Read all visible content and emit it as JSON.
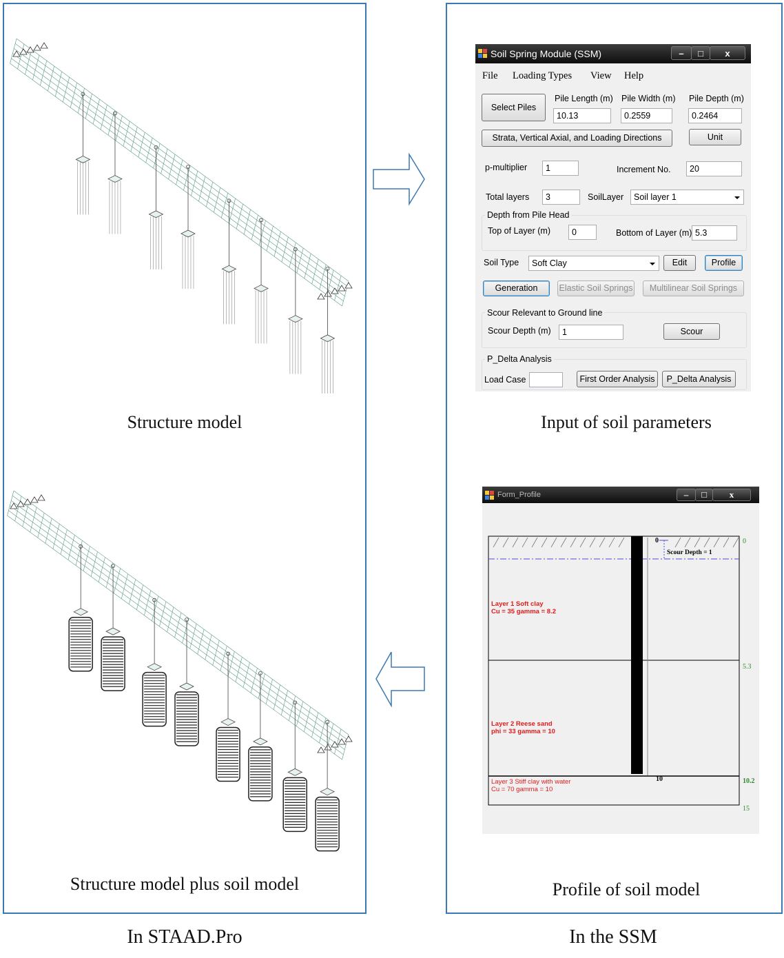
{
  "panels": {
    "structure_model": "Structure model",
    "structure_plus_soil": "Structure model plus soil model",
    "input_soil_params": "Input of soil parameters",
    "profile_soil_model": "Profile of soil model"
  },
  "bottom_labels": {
    "left": "In STAAD.Pro",
    "right": "In the SSM"
  },
  "ssm_window": {
    "title": "Soil Spring Module (SSM)",
    "controls": {
      "minimize": "–",
      "maximize": "□",
      "close": "x"
    },
    "menu": [
      "File",
      "Loading Types",
      "View",
      "Help"
    ],
    "select_piles": "Select Piles",
    "pile_length_label": "Pile Length (m)",
    "pile_length_value": "10.13",
    "pile_width_label": "Pile Width (m)",
    "pile_width_value": "0.2559",
    "pile_depth_label": "Pile Depth (m)",
    "pile_depth_value": "0.2464",
    "strata_button": "Strata, Vertical Axial, and Loading Directions",
    "unit_button": "Unit",
    "p_multiplier_label": "p-multiplier",
    "p_multiplier_value": "1",
    "increment_label": "Increment No.",
    "increment_value": "20",
    "total_layers_label": "Total layers",
    "total_layers_value": "3",
    "soil_layer_label": "SoilLayer",
    "soil_layer_value": "Soil layer 1",
    "depth_group_title": "Depth from Pile Head",
    "top_layer_label": "Top of Layer (m)",
    "top_layer_value": "0",
    "bottom_layer_label": "Bottom of Layer (m)",
    "bottom_layer_value": "5.3",
    "soil_type_label": "Soil Type",
    "soil_type_value": "Soft Clay",
    "edit_button": "Edit",
    "profile_button": "Profile",
    "generation_button": "Generation",
    "elastic_button": "Elastic Soil Springs",
    "multilinear_button": "Multilinear Soil Springs",
    "scour_group_title": "Scour Relevant to Ground line",
    "scour_depth_label": "Scour Depth (m)",
    "scour_depth_value": "1",
    "scour_button": "Scour",
    "pdelta_group_title": "P_Delta Analysis",
    "load_case_label": "Load Case",
    "load_case_value": "",
    "first_order_button": "First Order Analysis",
    "pdelta_button": "P_Delta Analysis"
  },
  "profile_window": {
    "title": "Form_Profile",
    "controls": {
      "minimize": "–",
      "maximize": "□",
      "close": "x"
    },
    "pile_top_label": "0",
    "pile_tip_label": "10",
    "scour_label": "Scour Depth = 1",
    "layer1_name": "Layer 1 Soft clay",
    "layer1_props": " Cu = 35 gamma = 8.2",
    "layer2_name": "Layer 2 Reese sand",
    "layer2_props": " phi = 33 gamma = 10",
    "layer3_name": "Layer 3 Stiff clay with water",
    "layer3_props": " Cu = 70 gamma = 10",
    "depth_ticks": [
      "0",
      "5.3",
      "10.2",
      "15"
    ]
  },
  "colors": {
    "panel_border": "#3a78b5",
    "arrow_stroke": "#3a78b5",
    "layer_text": "#e31b1b",
    "depth_text": "#2f8a2f",
    "scour_line": "#4a4ae0",
    "model_lines": "#5a9a8a"
  }
}
